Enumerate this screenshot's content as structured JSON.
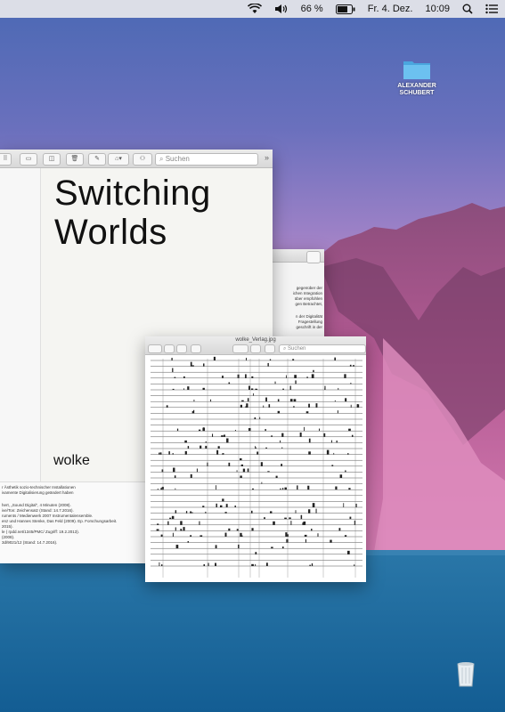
{
  "menubar": {
    "battery": "66 %",
    "date": "Fr. 4. Dez.",
    "time": "10:09",
    "icons": [
      "wifi-icon",
      "volume-icon",
      "battery-icon",
      "search-icon",
      "list-icon"
    ]
  },
  "desktop": {
    "folder": {
      "line1": "ALEXANDER",
      "line2": "SCHUBERT"
    }
  },
  "back_window": {
    "search_placeholder": "Suchen",
    "book_title_line1": "Switching",
    "book_title_line2": "Worlds",
    "brand": "wolke",
    "text_lines": [
      "r Ästhetik sozio-technischer Installationen",
      "ivamente Digitalisierung geändert haben",
      "",
      "hert, „Sound Digital“, 4 Minuten (2008).",
      "ive/Ton: Zeichensatz (Stand: 14.7.2016).",
      "ruments / Medienwerk 2007 Instrumentalensemble.",
      "enz und Hannes Stenke, Das Feld (2009). Ep. Forschungsarbeit.",
      "",
      "2015).",
      "le ( rpdd.net/1345/PMC/ Zugriff: 19.2.2013).",
      "(2008).",
      "3d/9021/12 (Stand: 14.7.2016)."
    ]
  },
  "middle_window": {
    "text_lines": [
      "gegenüber der",
      "ichen Integration",
      "über empfohlen",
      "gen Betrachtet,",
      "",
      "n der Digitalität",
      "Fragestellung",
      "geschrift in der"
    ]
  },
  "front_window": {
    "title": "wolke_Verlag.jpg",
    "search_placeholder": "Suchen"
  },
  "colors": {
    "menubar": "#e8e8ec",
    "folder": "#5ab5ea",
    "sea": "#16669e"
  }
}
